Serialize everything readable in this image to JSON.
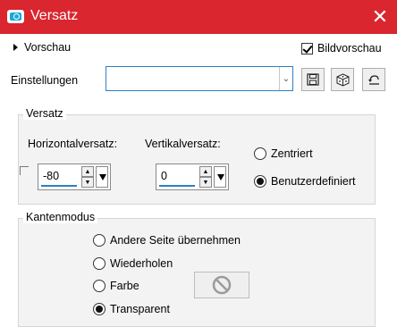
{
  "window": {
    "title": "Versatz"
  },
  "header": {
    "preview_label": "Vorschau",
    "bild_label": "Bildvorschau",
    "bild_checked": true
  },
  "settings": {
    "label": "Einstellungen",
    "value": ""
  },
  "offset": {
    "group_label": "Versatz",
    "horizontal_label": "Horizontalversatz:",
    "horizontal_value": "-80",
    "vertical_label": "Vertikalversatz:",
    "vertical_value": "0",
    "centered_label": "Zentriert",
    "custom_label": "Benutzerdefiniert",
    "selected": "custom"
  },
  "edge": {
    "group_label": "Kantenmodus",
    "options": [
      "Andere Seite übernehmen",
      "Wiederholen",
      "Farbe",
      "Transparent"
    ],
    "selected": "Transparent"
  },
  "icons": {
    "app": "app-camera-icon",
    "close": "close-icon",
    "expand": "expand-triangle-icon",
    "save": "save-icon",
    "random": "dice-icon",
    "reset": "reset-icon",
    "no_color": "no-color-icon"
  }
}
